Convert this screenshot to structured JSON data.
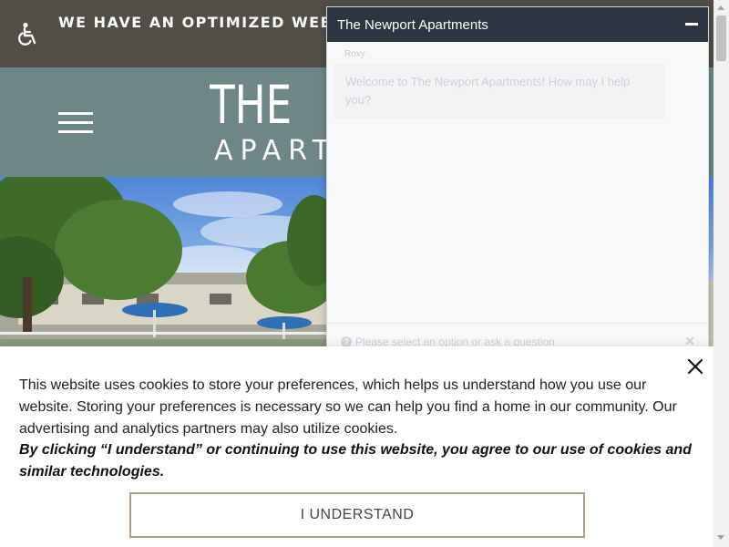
{
  "accessibility_banner": {
    "text": "WE HAVE AN OPTIMIZED WEB ACCESSIBILITY HERE TO VIEW.",
    "icon": "wheelchair-icon"
  },
  "header": {
    "logo_line1": "THE NEWPORT",
    "logo_line2": "APARTMENTS",
    "menu_icon": "hamburger-menu-icon",
    "background_color": "#6d8786"
  },
  "chat": {
    "title": "The Newport Apartments",
    "minimize_icon": "minimize-icon",
    "sender": "Roxy",
    "message": "Welcome to The Newport Apartments! How may I help you?",
    "input_placeholder": "Please select an option or ask a question",
    "help_icon": "question-icon",
    "clear_icon": "close-icon"
  },
  "cookie_banner": {
    "text": "This website uses cookies to store your preferences, which helps us understand how you use our website. Storing your preferences is necessary so we can help you find a home in our community. Our advertising and analytics partners may also utilize cookies.",
    "bold_text": "By clicking “I understand” or continuing to use this website, you agree to our use of cookies and similar technologies.",
    "button_label": "I UNDERSTAND",
    "close_icon": "close-icon",
    "button_border_color": "#a99e8c"
  }
}
